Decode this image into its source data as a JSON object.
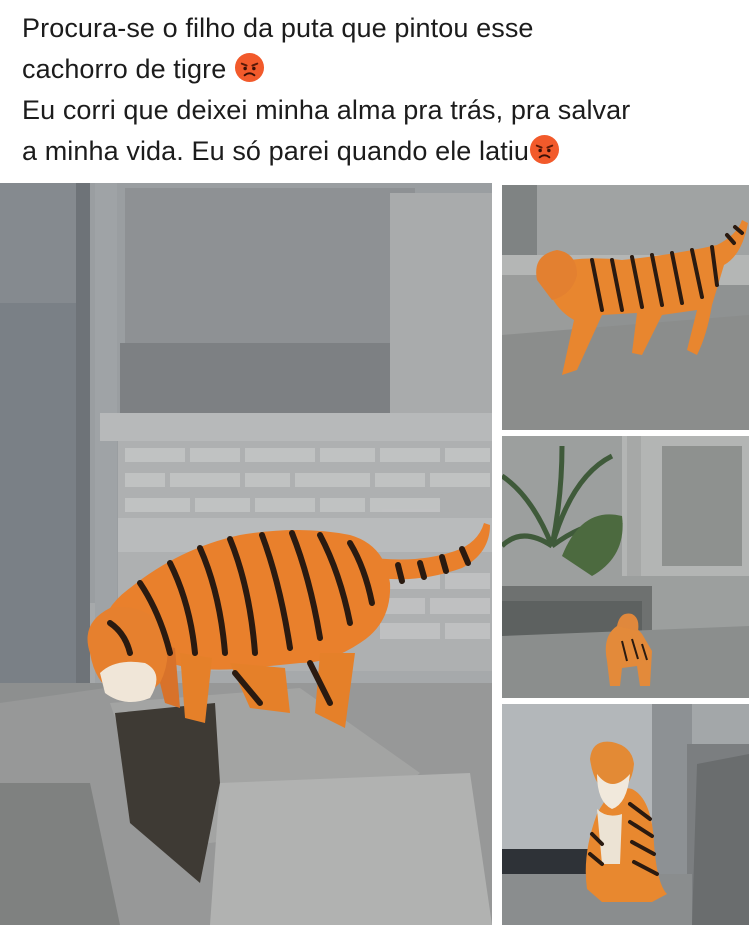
{
  "post": {
    "caption_lines": [
      "Procura-se o filho da puta que pintou esse",
      "cachorro de tigre",
      "Eu corri que deixei minha alma pra trás, pra salvar",
      "a minha vida. Eu só parei quando ele latiu"
    ],
    "emoji_icon": "angry-face-emoji"
  },
  "photos": [
    {
      "name": "dog-painted-tiger-large"
    },
    {
      "name": "dog-painted-tiger-walking"
    },
    {
      "name": "dog-painted-tiger-yard"
    },
    {
      "name": "dog-painted-tiger-sitting"
    }
  ],
  "colors": {
    "tiger_orange": "#e9802c",
    "stripe": "#2a1a10",
    "wall_gray": "#8f9498",
    "caption_text": "#1c1c1c"
  }
}
